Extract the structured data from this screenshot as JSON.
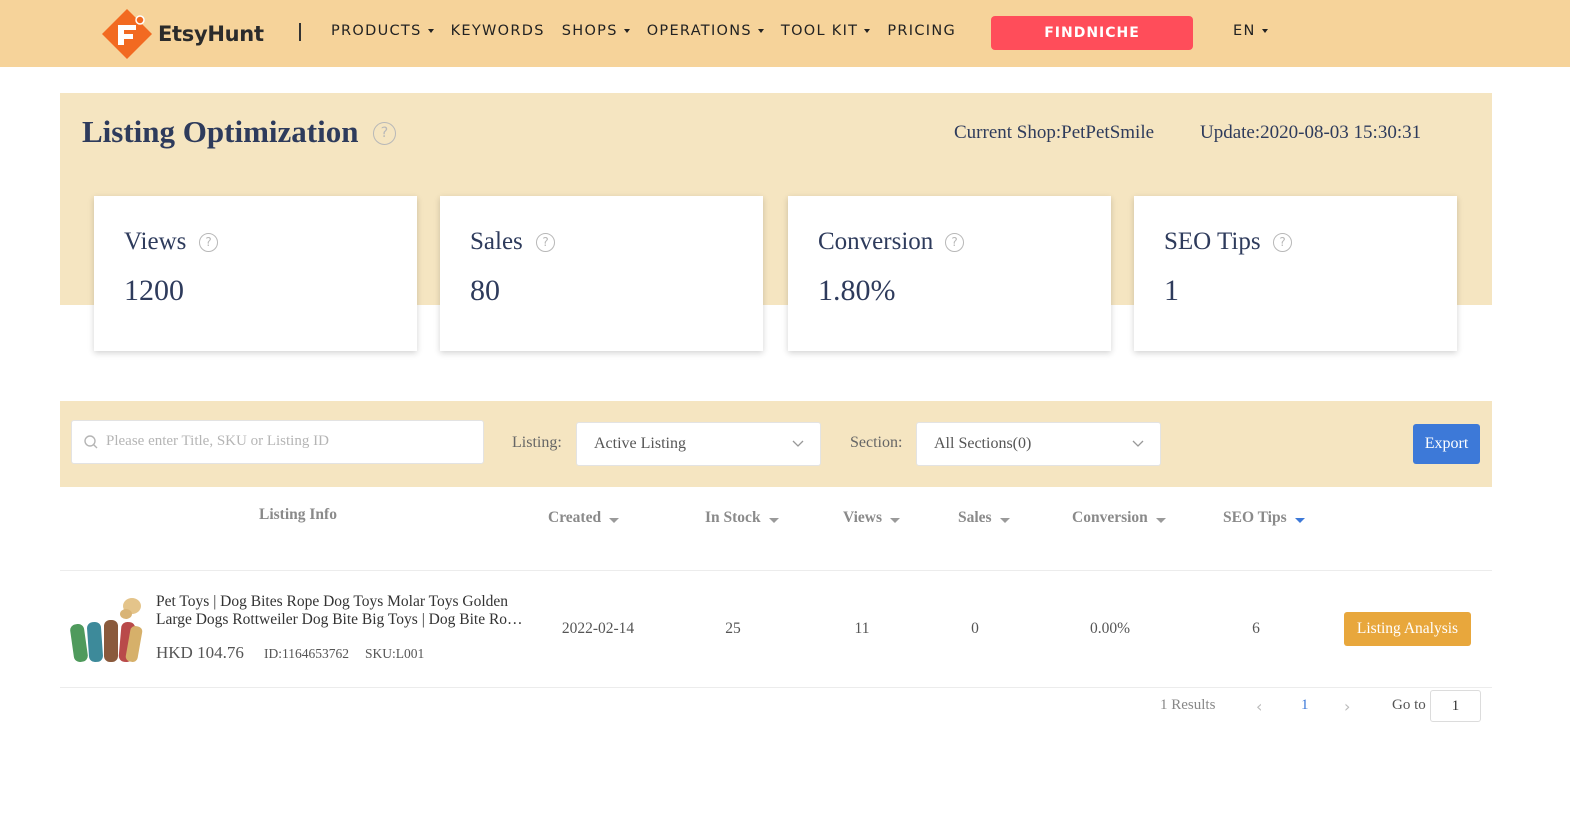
{
  "nav": {
    "brand": "EtsyHunt",
    "items": [
      {
        "label": "PRODUCTS",
        "dropdown": true
      },
      {
        "label": "KEYWORDS",
        "dropdown": false
      },
      {
        "label": "SHOPS",
        "dropdown": true
      },
      {
        "label": "OPERATIONS",
        "dropdown": true
      },
      {
        "label": "TOOL KIT",
        "dropdown": true
      },
      {
        "label": "PRICING",
        "dropdown": false
      }
    ],
    "cta": "FINDNICHE",
    "language": "EN"
  },
  "header": {
    "title": "Listing Optimization",
    "current_shop": "Current Shop:PetPetSmile",
    "update": "Update:2020-08-03 15:30:31"
  },
  "stats": [
    {
      "label": "Views",
      "value": "1200"
    },
    {
      "label": "Sales",
      "value": "80"
    },
    {
      "label": "Conversion",
      "value": "1.80%"
    },
    {
      "label": "SEO Tips",
      "value": "1"
    }
  ],
  "filters": {
    "search_placeholder": "Please enter Title, SKU or Listing ID",
    "listing_label": "Listing:",
    "listing_value": "Active Listing",
    "section_label": "Section:",
    "section_value": "All Sections(0)",
    "export": "Export"
  },
  "table": {
    "columns": [
      "Listing Info",
      "Created",
      "In Stock",
      "Views",
      "Sales",
      "Conversion",
      "SEO Tips"
    ],
    "rows": [
      {
        "title_line1": "Pet Toys | Dog Bites Rope Dog Toys Molar Toys Golden",
        "title_line2": "Large Dogs Rottweiler Dog Bite Big Toys | Dog Bite Rope Toys",
        "price": "HKD 104.76",
        "id": "ID:1164653762",
        "sku": "SKU:L001",
        "created": "2022-02-14",
        "in_stock": "25",
        "views": "11",
        "sales": "0",
        "conversion": "0.00%",
        "seo_tips": "6",
        "action": "Listing Analysis"
      }
    ]
  },
  "pagination": {
    "results": "1 Results",
    "current_page": "1",
    "goto_label": "Go to",
    "goto_value": "1"
  },
  "colors": {
    "nav_bg": "#f6d39a",
    "band_bg": "#f5e5c1",
    "cta": "#ff4d5a",
    "export": "#3d79d8",
    "action": "#e8a73c",
    "title": "#2e3b5c"
  }
}
